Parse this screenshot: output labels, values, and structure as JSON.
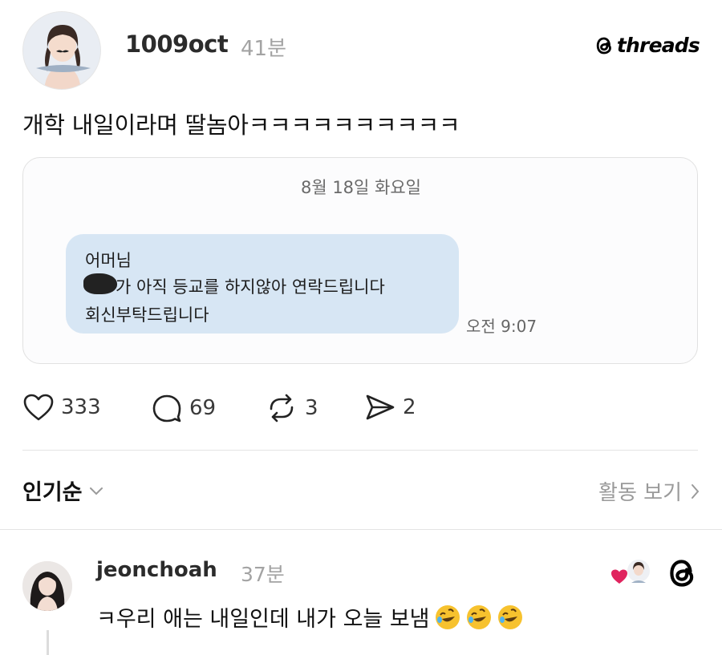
{
  "post": {
    "username": "1009oct",
    "time": "41분",
    "brand": "threads",
    "text": "개학 내일이라며 딸놈아ㅋㅋㅋㅋㅋㅋㅋㅋㅋㅋ"
  },
  "screenshot": {
    "date": "8월 18일 화요일",
    "line1": "어머님",
    "line2": "가 아직 등교를 하지않아 연락드립니다",
    "line3": "회신부탁드립니다",
    "time": "오전 9:07"
  },
  "actions": {
    "likes": "333",
    "comments": "69",
    "reposts": "3",
    "shares": "2"
  },
  "sort": {
    "label": "인기순",
    "activity": "활동 보기"
  },
  "comment": {
    "username": "jeonchoah",
    "time": "37분",
    "text": "ㅋ우리 애는 내일인데 내가 오늘 보냄",
    "emoji": [
      "rolling-on-floor-laughing",
      "rolling-on-floor-laughing",
      "rolling-on-floor-laughing"
    ]
  },
  "colors": {
    "bubble": "#d7e6f4",
    "heart_red": "#e0245e"
  }
}
